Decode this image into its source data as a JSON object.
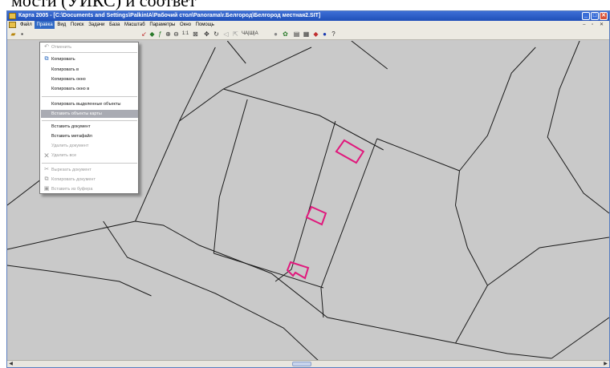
{
  "doc_text": "мости (УИКС) и соответ",
  "window": {
    "title": "Карта 2005 - [C:\\Documents and Settings\\PalkinIA\\Рабочий стол\\Panorama\\r.Белгород\\Белгород местная2.SIT]",
    "buttons": {
      "minimize": "_",
      "maximize": "□",
      "close": "✕"
    },
    "mdi_buttons": "– ▫ ✕"
  },
  "menubar": {
    "items": [
      "Файл",
      "Правка",
      "Вид",
      "Поиск",
      "Задачи",
      "База",
      "Масштаб",
      "Параметры",
      "Окно",
      "Помощь"
    ],
    "active": "Правка"
  },
  "toolbar": {
    "zoom_label": "1:1",
    "text_tools": "ЧА|Ш|А"
  },
  "edit_menu": {
    "items": [
      {
        "label": "Отменить",
        "icon": "undo-icon",
        "enabled": false
      },
      {
        "label": "Копировать",
        "icon": "copy-icon",
        "enabled": true
      },
      {
        "label": "Копировать в",
        "enabled": true
      },
      {
        "label": "Копировать окно",
        "enabled": true
      },
      {
        "label": "Копировать окно в",
        "enabled": true
      },
      {
        "label": "Копировать выделенные объекты",
        "enabled": true
      },
      {
        "label": "Вставить объекты карты",
        "enabled": true,
        "highlighted": true
      },
      {
        "label": "Вставить документ",
        "enabled": true
      },
      {
        "label": "Вставить метафайл",
        "enabled": true
      },
      {
        "label": "Удалить документ",
        "enabled": false
      },
      {
        "label": "Удалить все",
        "icon": "delete-icon",
        "enabled": false
      },
      {
        "label": "Вырезать документ",
        "icon": "cut-icon",
        "enabled": false
      },
      {
        "label": "Копировать документ",
        "icon": "copy-doc-icon",
        "enabled": false
      },
      {
        "label": "Вставить из буфера",
        "icon": "paste-icon",
        "enabled": false
      }
    ]
  },
  "colors": {
    "map_background": "#c9c9c9",
    "parcel_lines": "#1a1a1a",
    "highlight_objects": "#e0187c",
    "titlebar": "#2458c6",
    "menu_highlight": "#a9abb3"
  }
}
